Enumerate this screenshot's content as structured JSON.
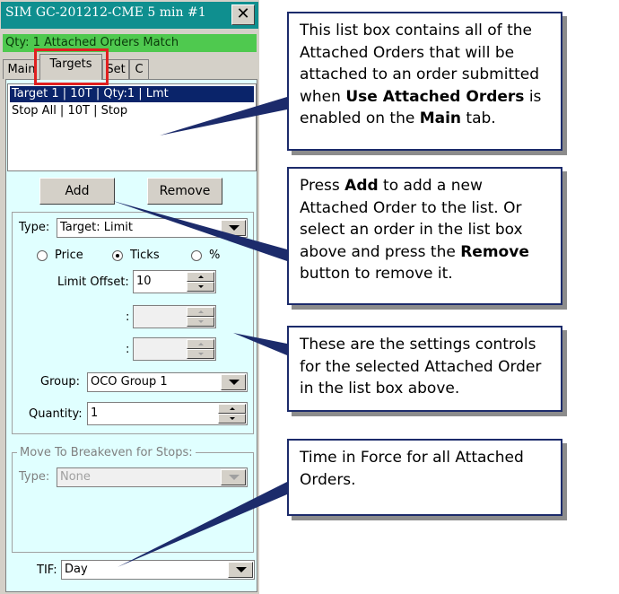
{
  "window": {
    "title": "SIM GC-201212-CME  5 min  #1",
    "close_label": "✕",
    "status_text": "Qty: 1 Attached Orders Match"
  },
  "tabs": [
    {
      "label": "Main"
    },
    {
      "label": "Targets",
      "active": true
    },
    {
      "label": "Set"
    },
    {
      "label": "C"
    }
  ],
  "orders_list": {
    "items": [
      {
        "label": "Target 1 | 10T | Qty:1 | Lmt",
        "selected": true
      },
      {
        "label": "Stop All | 10T | Stop",
        "selected": false
      }
    ]
  },
  "buttons": {
    "add": "Add",
    "remove": "Remove"
  },
  "settings": {
    "type_label": "Type:",
    "type_value": "Target: Limit",
    "radio_price": "Price",
    "radio_ticks": "Ticks",
    "radio_percent": "%",
    "selected_radio": "Ticks",
    "limit_offset_label": "Limit Offset:",
    "limit_offset_value": "10",
    "blank_label_1": ":",
    "blank_label_2": ":",
    "group_label": "Group:",
    "group_value": "OCO Group 1",
    "quantity_label": "Quantity:",
    "quantity_value": "1"
  },
  "breakeven": {
    "group_title": "Move To Breakeven for Stops:",
    "type_label": "Type:",
    "type_value": "None"
  },
  "tif": {
    "label": "TIF:",
    "value": "Day"
  },
  "callouts": {
    "list_box": {
      "parts": [
        {
          "text": "This list box contains all of the Attached Orders that will be attached to an order submitted when ",
          "bold": false
        },
        {
          "text": "Use Attached Orders",
          "bold": true
        },
        {
          "text": " is enabled on the ",
          "bold": false
        },
        {
          "text": "Main",
          "bold": true
        },
        {
          "text": " tab.",
          "bold": false
        }
      ]
    },
    "add_remove": {
      "parts": [
        {
          "text": "Press ",
          "bold": false
        },
        {
          "text": "Add",
          "bold": true
        },
        {
          "text": " to add a new Attached Order to the list.  Or select an order in the list box above and press the ",
          "bold": false
        },
        {
          "text": "Remove",
          "bold": true
        },
        {
          "text": " button to remove it.",
          "bold": false
        }
      ]
    },
    "settings": {
      "parts": [
        {
          "text": "These are the settings controls for the selected Attached Order in the list box above.",
          "bold": false
        }
      ]
    },
    "tif": {
      "parts": [
        {
          "text": "Time in Force for all Attached Orders.",
          "bold": false
        }
      ]
    }
  },
  "colors": {
    "title_bar": "#0f8f8f",
    "status_bar": "#4fc94f",
    "tab_page": "#e0ffff",
    "selection": "#0a246a",
    "tab_highlight": "#e02020",
    "callout_border": "#1c2b6b"
  }
}
